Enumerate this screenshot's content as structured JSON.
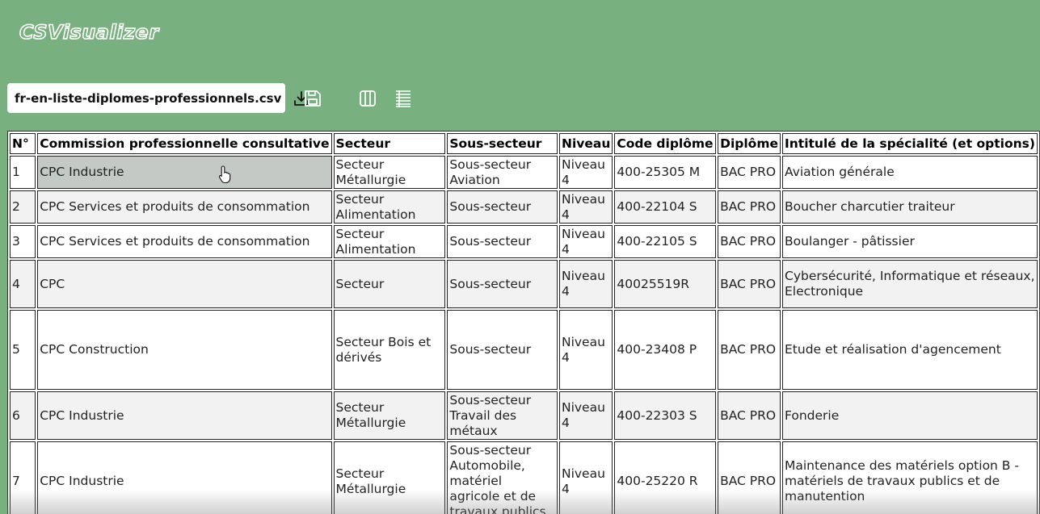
{
  "app": {
    "logo": "CSVisualizer"
  },
  "toolbar": {
    "file_name": "fr-en-liste-diplomes-professionnels.csv",
    "download_icon": "download-icon",
    "save_icon": "save-icon",
    "columns_icon": "columns-icon",
    "rows_icon": "rows-icon"
  },
  "table": {
    "headers": [
      "N°",
      "Commission professionnelle consultative",
      "Secteur",
      "Sous-secteur",
      "Niveau",
      "Code diplôme",
      "Diplôme",
      "Intitulé de la spécialité (et options)"
    ],
    "rows": [
      [
        "1",
        "CPC Industrie",
        "Secteur Métallurgie",
        "Sous-secteur Aviation",
        "Niveau 4",
        "400-25305 M",
        "BAC PRO",
        "Aviation générale"
      ],
      [
        "2",
        "CPC Services et produits de consommation",
        "Secteur Alimentation",
        "Sous-secteur",
        "Niveau 4",
        "400-22104 S",
        "BAC PRO",
        "Boucher charcutier traiteur"
      ],
      [
        "3",
        "CPC Services et produits de consommation",
        "Secteur Alimentation",
        "Sous-secteur",
        "Niveau 4",
        "400-22105 S",
        "BAC PRO",
        "Boulanger - pâtissier"
      ],
      [
        "4",
        "CPC",
        "Secteur",
        "Sous-secteur",
        "Niveau 4",
        "40025519R",
        "BAC PRO",
        "Cybersécurité, Informatique et réseaux, Electronique"
      ],
      [
        "5",
        "CPC Construction",
        "Secteur Bois et dérivés",
        "Sous-secteur",
        "Niveau 4",
        "400-23408 P",
        "BAC PRO",
        "Etude et réalisation d'agencement"
      ],
      [
        "6",
        "CPC Industrie",
        "Secteur Métallurgie",
        "Sous-secteur Travail des métaux",
        "Niveau 4",
        "400-22303 S",
        "BAC PRO",
        "Fonderie"
      ],
      [
        "7",
        "CPC Industrie",
        "Secteur Métallurgie",
        "Sous-secteur Automobile, matériel agricole et de travaux publics",
        "Niveau 4",
        "400-25220 R",
        "BAC PRO",
        "Maintenance des matériels option B - matériels de travaux publics et de manutention"
      ]
    ]
  }
}
